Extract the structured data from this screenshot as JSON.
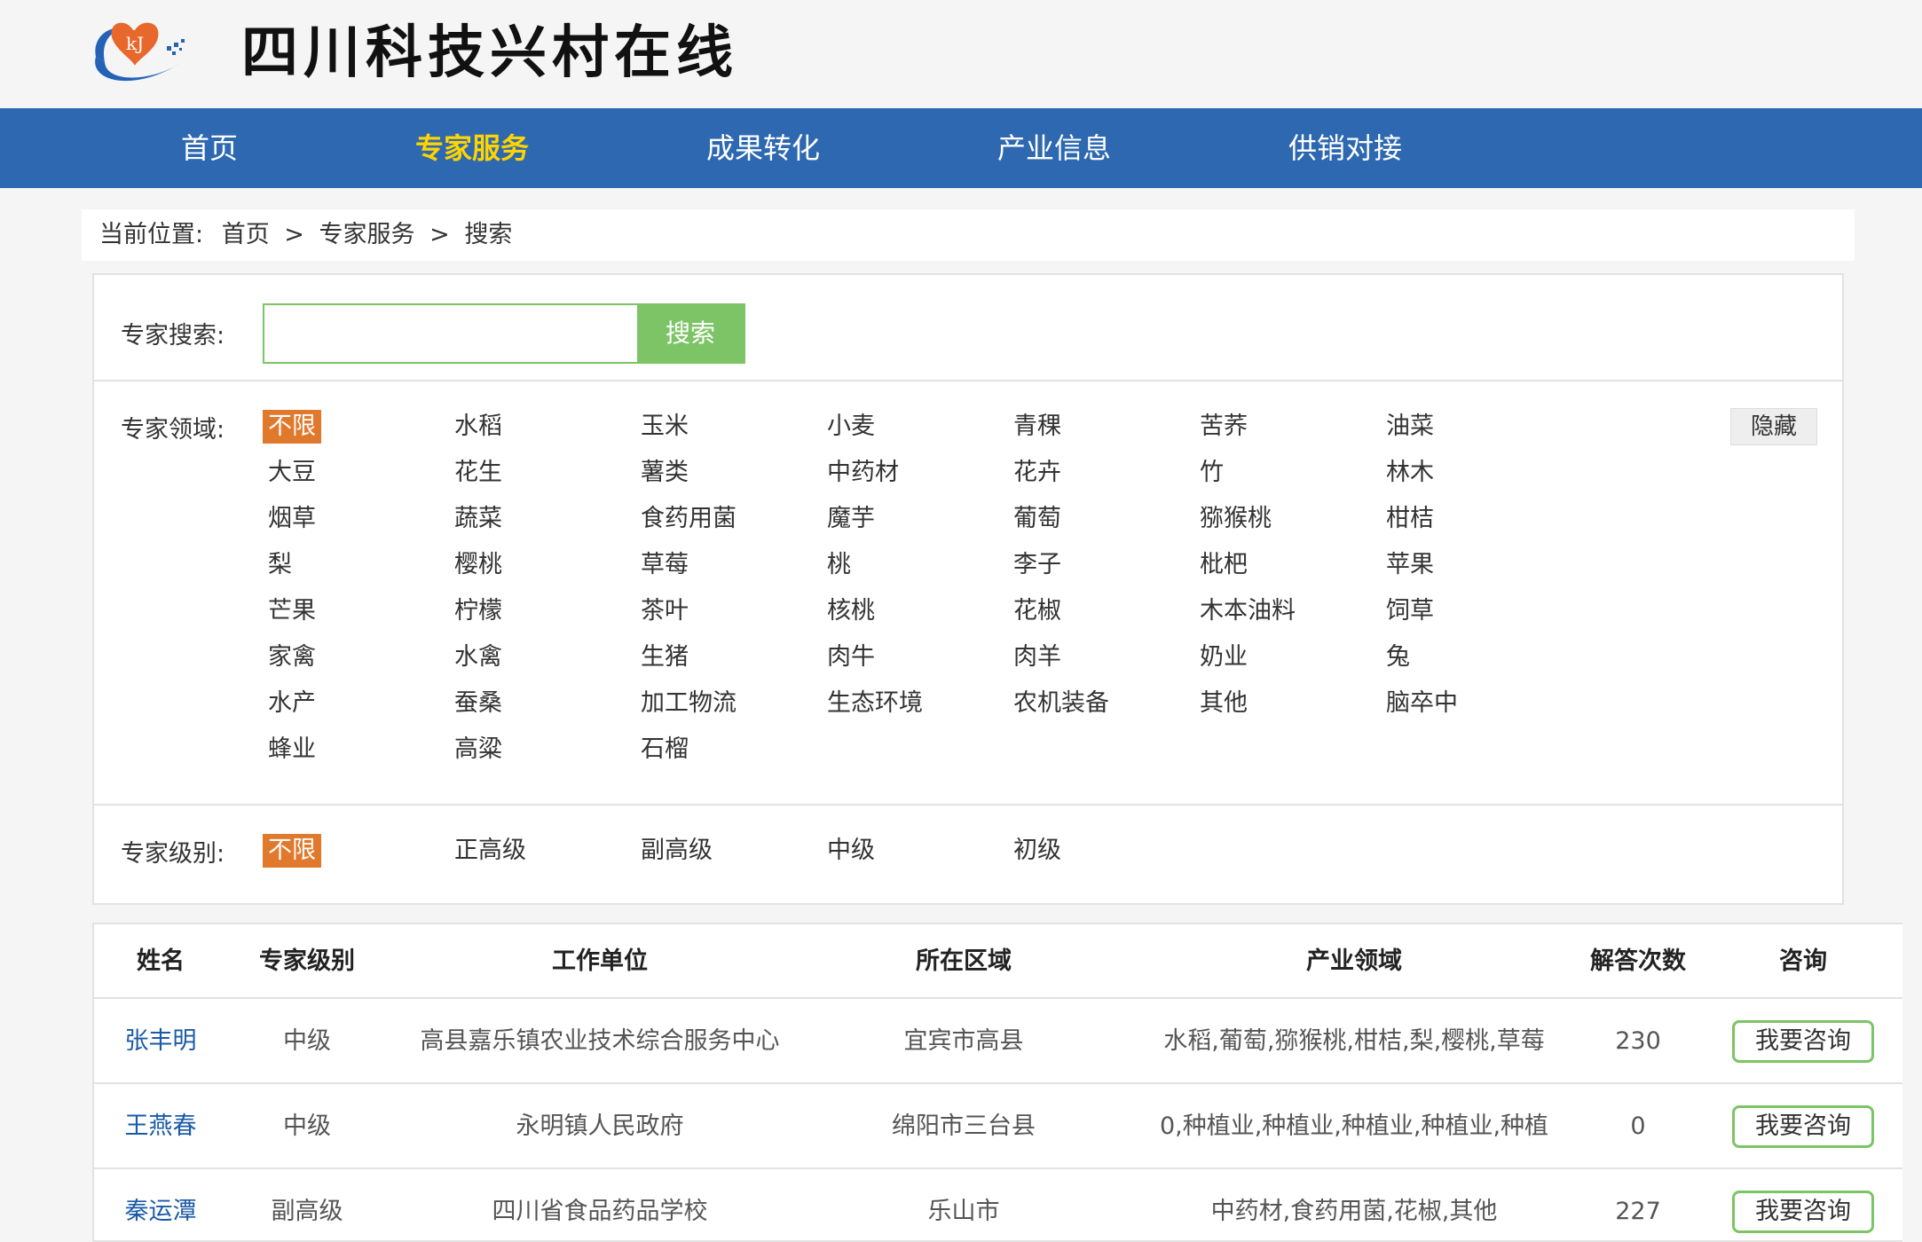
{
  "header": {
    "site_title": "四川科技兴村在线",
    "logo_text": "kJ"
  },
  "nav": [
    "首页",
    "专家服务",
    "成果转化",
    "产业信息",
    "供销对接"
  ],
  "breadcrumb": {
    "prefix": "当前位置:",
    "items": [
      "首页",
      "专家服务",
      "搜索"
    ],
    "separator": ">"
  },
  "search": {
    "label": "专家搜索:",
    "value": "",
    "placeholder": "",
    "button": "搜索"
  },
  "domains": {
    "label": "专家领域:",
    "selected": "不限",
    "hide_button": "隐藏",
    "rows": [
      [
        "不限",
        "水稻",
        "玉米",
        "小麦",
        "青稞",
        "苦荞",
        "油菜"
      ],
      [
        "大豆",
        "花生",
        "薯类",
        "中药材",
        "花卉",
        "竹",
        "林木"
      ],
      [
        "烟草",
        "蔬菜",
        "食药用菌",
        "魔芋",
        "葡萄",
        "猕猴桃",
        "柑桔"
      ],
      [
        "梨",
        "樱桃",
        "草莓",
        "桃",
        "李子",
        "枇杷",
        "苹果"
      ],
      [
        "芒果",
        "柠檬",
        "茶叶",
        "核桃",
        "花椒",
        "木本油料",
        "饲草"
      ],
      [
        "家禽",
        "水禽",
        "生猪",
        "肉牛",
        "肉羊",
        "奶业",
        "兔"
      ],
      [
        "水产",
        "蚕桑",
        "加工物流",
        "生态环境",
        "农机装备",
        "其他",
        "脑卒中"
      ],
      [
        "蜂业",
        "高粱",
        "石榴"
      ]
    ]
  },
  "levels": {
    "label": "专家级别:",
    "selected": "不限",
    "options": [
      "不限",
      "正高级",
      "副高级",
      "中级",
      "初级"
    ]
  },
  "table": {
    "headers": [
      "姓名",
      "专家级别",
      "工作单位",
      "所在区域",
      "产业领域",
      "解答次数",
      "咨询"
    ],
    "rows": [
      [
        "张丰明",
        "中级",
        "高县嘉乐镇农业技术综合服务中心",
        "宜宾市高县",
        "水稻,葡萄,猕猴桃,柑桔,梨,樱桃,草莓",
        "230",
        "我要咨询"
      ],
      [
        "王燕春",
        "中级",
        "永明镇人民政府",
        "绵阳市三台县",
        "0,种植业,种植业,种植业,种植业,种植",
        "0",
        "我要咨询"
      ],
      [
        "秦运潭",
        "副高级",
        "四川省食品药品学校",
        "乐山市",
        "中药材,食药用菌,花椒,其他",
        "227",
        "我要咨询"
      ]
    ]
  },
  "colors": {
    "nav_bg": "#2d68b0",
    "nav_active": "#ffd400",
    "selected_tag": "#e0792c",
    "search_green": "#7cc466",
    "name_link": "#1a5aa8"
  }
}
